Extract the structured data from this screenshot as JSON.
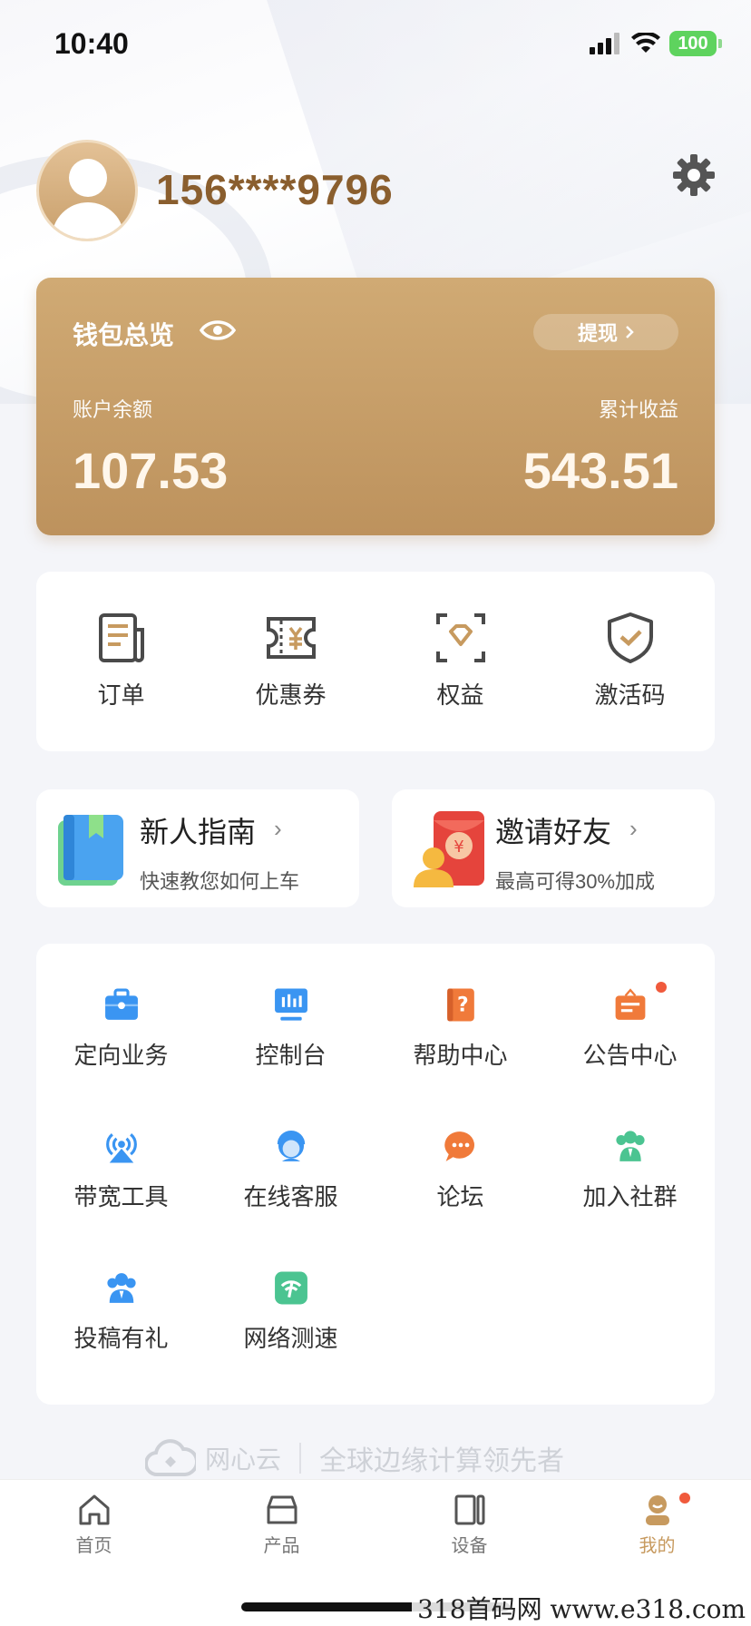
{
  "status": {
    "time": "10:40",
    "battery": "100"
  },
  "profile": {
    "phone": "156****9796"
  },
  "wallet": {
    "title": "钱包总览",
    "withdraw_label": "提现",
    "balance_label": "账户余额",
    "balance_value": "107.53",
    "earnings_label": "累计收益",
    "earnings_value": "543.51"
  },
  "quick_actions": [
    {
      "label": "订单",
      "icon": "order-icon"
    },
    {
      "label": "优惠券",
      "icon": "coupon-icon"
    },
    {
      "label": "权益",
      "icon": "diamond-icon"
    },
    {
      "label": "激活码",
      "icon": "shield-check-icon"
    }
  ],
  "promos": [
    {
      "title": "新人指南",
      "subtitle": "快速教您如何上车",
      "icon": "book-icon"
    },
    {
      "title": "邀请好友",
      "subtitle": "最高可得30%加成",
      "icon": "red-envelope-icon"
    }
  ],
  "services": [
    {
      "label": "定向业务",
      "icon": "briefcase-icon",
      "color": "#3a95f2"
    },
    {
      "label": "控制台",
      "icon": "monitor-icon",
      "color": "#3a95f2"
    },
    {
      "label": "帮助中心",
      "icon": "help-book-icon",
      "color": "#f07a3a"
    },
    {
      "label": "公告中心",
      "icon": "notice-icon",
      "color": "#f07a3a",
      "badge": true
    },
    {
      "label": "带宽工具",
      "icon": "antenna-icon",
      "color": "#3a95f2"
    },
    {
      "label": "在线客服",
      "icon": "service-agent-icon",
      "color": "#3a95f2"
    },
    {
      "label": "论坛",
      "icon": "chat-bubble-icon",
      "color": "#f07a3a"
    },
    {
      "label": "加入社群",
      "icon": "group-icon",
      "color": "#4bc491"
    },
    {
      "label": "投稿有礼",
      "icon": "users-icon",
      "color": "#3a95f2"
    },
    {
      "label": "网络测速",
      "icon": "speed-icon",
      "color": "#4bc491"
    }
  ],
  "slogan": {
    "brand": "网心云",
    "tagline": "全球边缘计算领先者"
  },
  "tabs": [
    {
      "label": "首页",
      "icon": "home-icon",
      "active": false
    },
    {
      "label": "产品",
      "icon": "product-icon",
      "active": false
    },
    {
      "label": "设备",
      "icon": "device-icon",
      "active": false
    },
    {
      "label": "我的",
      "icon": "mine-icon",
      "active": true
    }
  ],
  "watermark": "318首码网  www.e318.com",
  "colors": {
    "gold": "#c79a5f",
    "blue": "#3a95f2",
    "orange": "#f07a3a",
    "green": "#4bc491"
  }
}
